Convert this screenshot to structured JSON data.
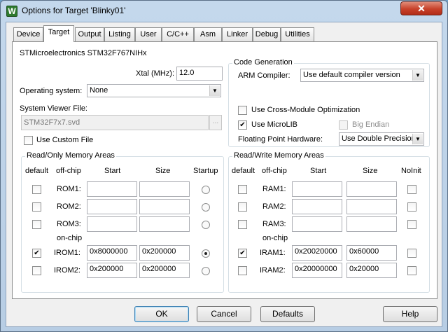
{
  "window": {
    "title": "Options for Target 'Blinky01'",
    "close_glyph": "✕",
    "app_icon_glyph": "W"
  },
  "tabs": [
    "Device",
    "Target",
    "Output",
    "Listing",
    "User",
    "C/C++",
    "Asm",
    "Linker",
    "Debug",
    "Utilities"
  ],
  "active_tab": "Target",
  "target": {
    "device_name": "STMicroelectronics STM32F767NIHx",
    "xtal_label": "Xtal (MHz):",
    "xtal_value": "12.0",
    "os_label": "Operating system:",
    "os_value": "None",
    "svd_label": "System Viewer File:",
    "svd_value": "STM32F7x7.svd",
    "svd_browse": "...",
    "custom_file_label": "Use Custom File",
    "custom_file_checked": false
  },
  "code_gen": {
    "title": "Code Generation",
    "compiler_label": "ARM Compiler:",
    "compiler_value": "Use default compiler version",
    "cross_module_label": "Use Cross-Module Optimization",
    "cross_module_checked": false,
    "microlib_label": "Use MicroLIB",
    "microlib_checked": true,
    "big_endian_label": "Big Endian",
    "big_endian_checked": false,
    "fp_label": "Floating Point Hardware:",
    "fp_value": "Use Double Precision"
  },
  "ro_memory": {
    "title": "Read/Only Memory Areas",
    "col_default": "default",
    "col_offchip": "off-chip",
    "col_start": "Start",
    "col_size": "Size",
    "col_startup": "Startup",
    "onchip_label": "on-chip",
    "rows": [
      {
        "name": "ROM1:",
        "default": false,
        "start": "",
        "size": "",
        "selected": false
      },
      {
        "name": "ROM2:",
        "default": false,
        "start": "",
        "size": "",
        "selected": false
      },
      {
        "name": "ROM3:",
        "default": false,
        "start": "",
        "size": "",
        "selected": false
      },
      {
        "name": "IROM1:",
        "default": true,
        "start": "0x8000000",
        "size": "0x200000",
        "selected": true
      },
      {
        "name": "IROM2:",
        "default": false,
        "start": "0x200000",
        "size": "0x200000",
        "selected": false
      }
    ]
  },
  "rw_memory": {
    "title": "Read/Write Memory Areas",
    "col_default": "default",
    "col_offchip": "off-chip",
    "col_start": "Start",
    "col_size": "Size",
    "col_noinit": "NoInit",
    "onchip_label": "on-chip",
    "rows": [
      {
        "name": "RAM1:",
        "default": false,
        "start": "",
        "size": "",
        "noinit": false
      },
      {
        "name": "RAM2:",
        "default": false,
        "start": "",
        "size": "",
        "noinit": false
      },
      {
        "name": "RAM3:",
        "default": false,
        "start": "",
        "size": "",
        "noinit": false
      },
      {
        "name": "IRAM1:",
        "default": true,
        "start": "0x20020000",
        "size": "0x60000",
        "noinit": false
      },
      {
        "name": "IRAM2:",
        "default": false,
        "start": "0x20000000",
        "size": "0x20000",
        "noinit": false
      }
    ]
  },
  "buttons": {
    "ok": "OK",
    "cancel": "Cancel",
    "defaults": "Defaults",
    "help": "Help"
  },
  "glyphs": {
    "check": "✔",
    "combo_arrow": "▼"
  }
}
